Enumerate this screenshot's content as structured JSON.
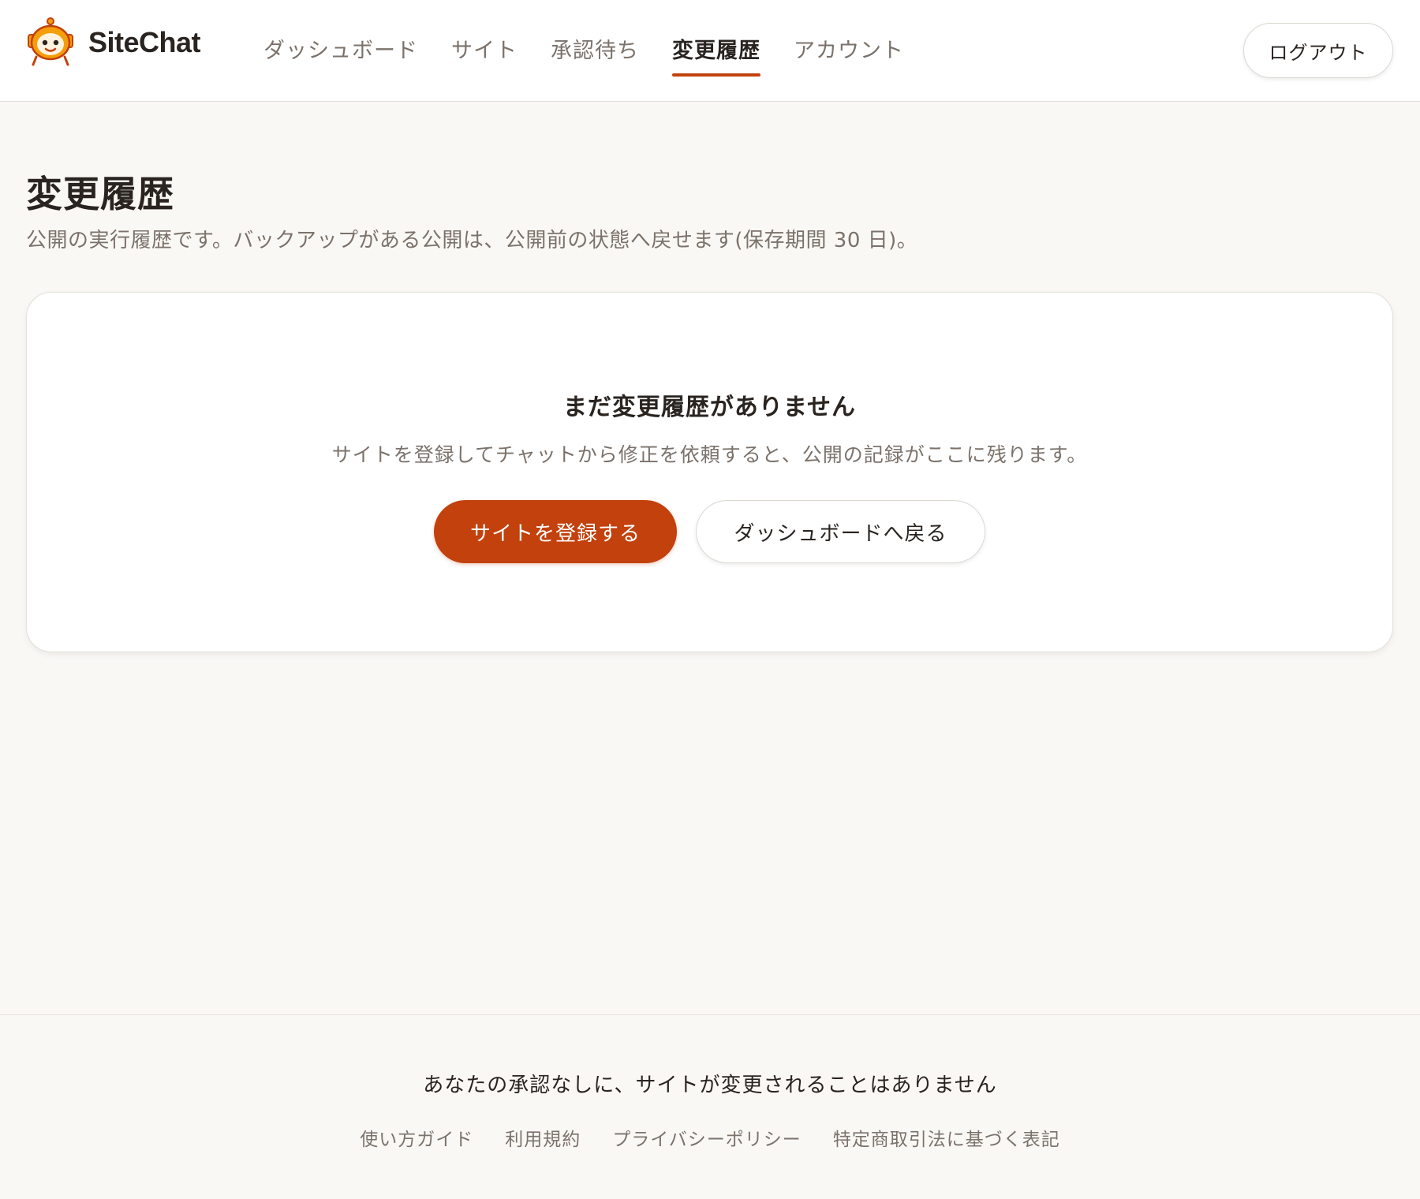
{
  "app": {
    "name": "SiteChat",
    "logo_icon": "robot-mascot-icon",
    "accent_color": "#c2410c"
  },
  "header": {
    "nav": [
      {
        "label": "ダッシュボード",
        "active": false
      },
      {
        "label": "サイト",
        "active": false
      },
      {
        "label": "承認待ち",
        "active": false
      },
      {
        "label": "変更履歴",
        "active": true
      },
      {
        "label": "アカウント",
        "active": false
      }
    ],
    "logout_label": "ログアウト"
  },
  "main": {
    "title": "変更履歴",
    "description": "公開の実行履歴です。バックアップがある公開は、公開前の状態へ戻せます(保存期間 30 日)。",
    "empty_state": {
      "title": "まだ変更履歴がありません",
      "description": "サイトを登録してチャットから修正を依頼すると、公開の記録がここに残ります。",
      "primary_button": "サイトを登録する",
      "secondary_button": "ダッシュボードへ戻る"
    }
  },
  "footer": {
    "tagline": "あなたの承認なしに、サイトが変更されることはありません",
    "links": [
      "使い方ガイド",
      "利用規約",
      "プライバシーポリシー",
      "特定商取引法に基づく表記"
    ]
  }
}
